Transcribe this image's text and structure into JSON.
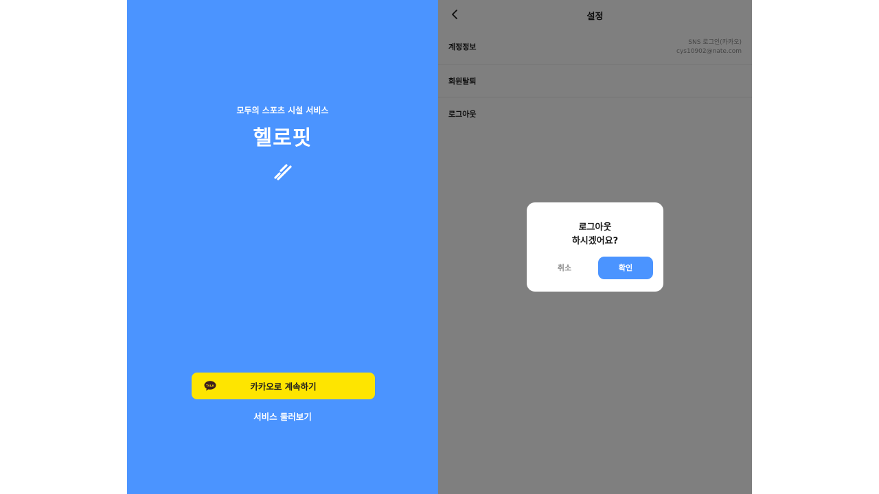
{
  "login": {
    "tagline": "모두의 스포츠 시설 서비스",
    "app_title": "헬로핏",
    "kakao_button_label": "카카오로 계속하기",
    "kakao_icon_text": "TALK",
    "browse_label": "서비스 둘러보기"
  },
  "settings": {
    "title": "설정",
    "rows": [
      {
        "label": "계정정보",
        "value_line1": "SNS 로그인(카카오)",
        "value_line2": "cys10902@nate.com"
      },
      {
        "label": "회원탈퇴"
      },
      {
        "label": "로그아웃"
      }
    ]
  },
  "dialog": {
    "message_line1": "로그아웃",
    "message_line2": "하시겠어요?",
    "cancel_label": "취소",
    "confirm_label": "확인"
  },
  "colors": {
    "brand_blue": "#4b94ff",
    "kakao_yellow": "#fee500",
    "overlay": "rgba(0,0,0,0.5)"
  },
  "icons": [
    "logo-mark-icon",
    "kakao-talk-icon",
    "back-arrow-icon"
  ]
}
